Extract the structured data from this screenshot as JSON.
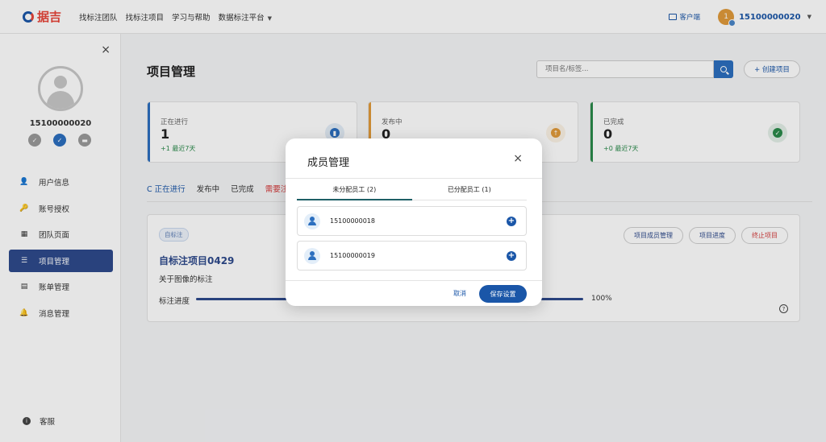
{
  "topbar": {
    "logo_text": "据吉",
    "nav": [
      "找标注团队",
      "找标注项目",
      "学习与帮助",
      "数据标注平台"
    ],
    "client_label": "客户端",
    "user_badge": "1",
    "user_name": "15100000020"
  },
  "sidebar": {
    "close": "×",
    "profile_name": "15100000020",
    "items": [
      {
        "label": "用户信息",
        "icon": "👤"
      },
      {
        "label": "账号授权",
        "icon": "🔑"
      },
      {
        "label": "团队页面",
        "icon": "▦"
      },
      {
        "label": "项目管理",
        "icon": "☰"
      },
      {
        "label": "账单管理",
        "icon": "▤"
      },
      {
        "label": "消息管理",
        "icon": "🔔"
      }
    ],
    "service_label": "客服"
  },
  "main": {
    "page_title": "项目管理",
    "search_placeholder": "项目名/标签...",
    "create_label": "+ 创建项目",
    "stats": [
      {
        "label": "正在进行",
        "value": "1",
        "delta": "+1 最近7天",
        "color": "#2c6fbf",
        "icon": "doc"
      },
      {
        "label": "发布中",
        "value": "0",
        "delta": "",
        "color": "#e09a3a",
        "icon": "upload"
      },
      {
        "label": "已完成",
        "value": "0",
        "delta": "+0 最近7天",
        "color": "#2a8a4a",
        "icon": "check"
      }
    ],
    "tabs": [
      "C 正在进行",
      "发布中",
      "已完成",
      "需要注"
    ],
    "project": {
      "chip": "自标注",
      "title": "自标注项目0429",
      "desc": "关于图像的标注",
      "progress_label": "标注进度",
      "progress": 1.0,
      "progress_text": "100%",
      "actions": [
        "项目成员管理",
        "项目进度",
        "终止项目"
      ]
    }
  },
  "modal": {
    "title": "成员管理",
    "close": "×",
    "tabs": [
      "未分配员工 (2)",
      "已分配员工 (1)"
    ],
    "members": [
      "15100000018",
      "15100000019"
    ],
    "cancel": "取消",
    "save": "保存设置"
  }
}
